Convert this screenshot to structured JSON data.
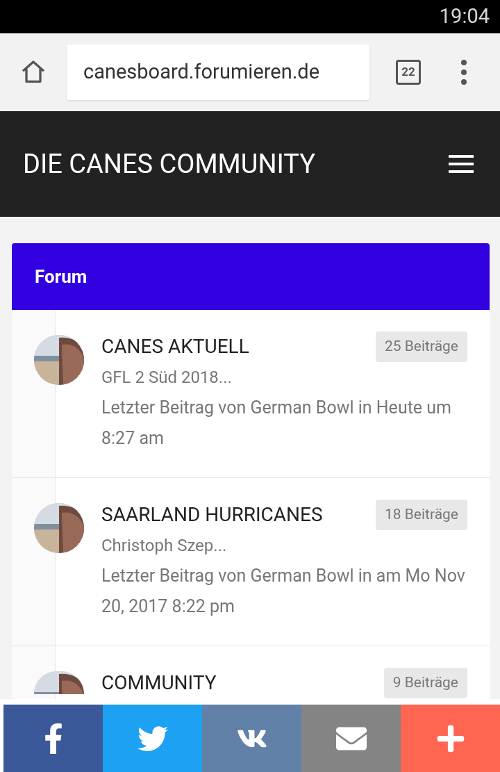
{
  "status_bar": {
    "time": "19:04"
  },
  "browser": {
    "url": "canesboard.forumieren.de",
    "tab_count": "22"
  },
  "header": {
    "title": "DIE CANES COMMUNITY"
  },
  "forum": {
    "title": "Forum",
    "rows": [
      {
        "title": "CANES AKTUELL",
        "badge": "25 Beiträge",
        "last_topic": "GFL 2 Süd 2018...",
        "last_post": "Letzter Beitrag von German Bowl in Heute um 8:27 am"
      },
      {
        "title": "SAARLAND HURRICANES",
        "badge": "18 Beiträge",
        "last_topic": "Christoph Szep...",
        "last_post": "Letzter Beitrag von German Bowl in am Mo Nov 20, 2017 8:22 pm"
      },
      {
        "title": "COMMUNITY",
        "badge": "9 Beiträge"
      }
    ]
  },
  "share_buttons": [
    {
      "kind": "facebook",
      "color": "#3b5998"
    },
    {
      "kind": "twitter",
      "color": "#1da1f2"
    },
    {
      "kind": "vk",
      "color": "#6181a8"
    },
    {
      "kind": "email",
      "color": "#848484"
    },
    {
      "kind": "more",
      "color": "#ff6550"
    }
  ]
}
